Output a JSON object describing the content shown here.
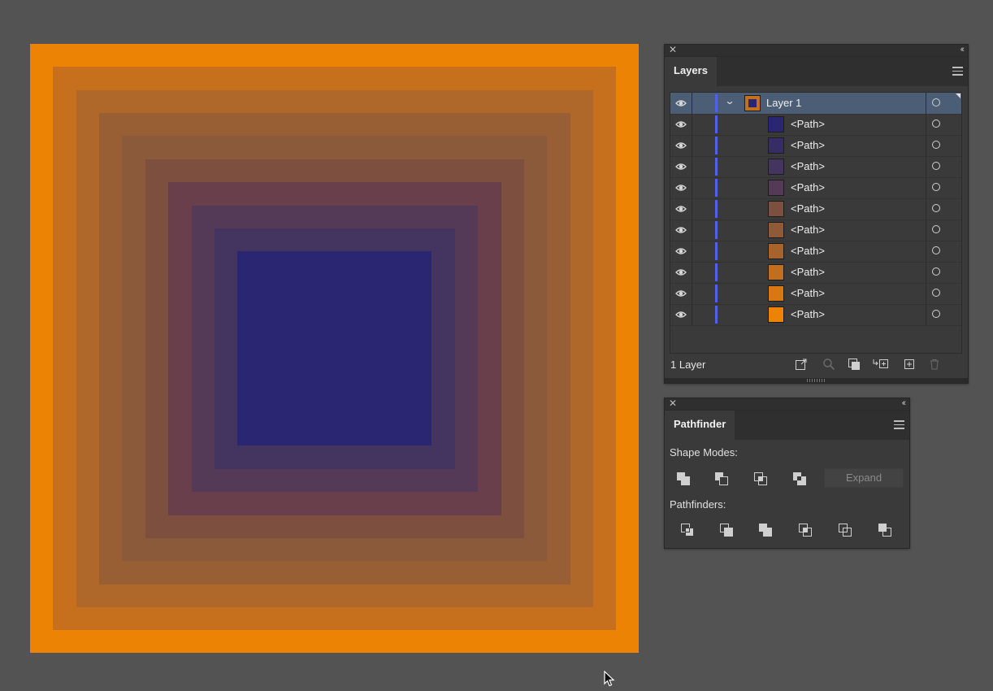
{
  "artboard": {
    "squares": [
      "#ec8305",
      "#c6701d",
      "#b0682a",
      "#985f34",
      "#8a5a3a",
      "#7d4f3f",
      "#683f4b",
      "#553a57",
      "#443460",
      "#2b2672"
    ]
  },
  "layers_panel": {
    "title": "Layers",
    "layer": {
      "name": "Layer 1",
      "color": "#4f63ea"
    },
    "paths": [
      {
        "name": "<Path>",
        "color": "#2b2672"
      },
      {
        "name": "<Path>",
        "color": "#362c66"
      },
      {
        "name": "<Path>",
        "color": "#443460"
      },
      {
        "name": "<Path>",
        "color": "#553a57"
      },
      {
        "name": "<Path>",
        "color": "#7d4f3f"
      },
      {
        "name": "<Path>",
        "color": "#8f5a35"
      },
      {
        "name": "<Path>",
        "color": "#a8632c"
      },
      {
        "name": "<Path>",
        "color": "#c16e20"
      },
      {
        "name": "<Path>",
        "color": "#d87812"
      },
      {
        "name": "<Path>",
        "color": "#ec8305"
      }
    ],
    "footer": {
      "count": "1 Layer"
    }
  },
  "pathfinder_panel": {
    "title": "Pathfinder",
    "shape_modes_label": "Shape Modes:",
    "pathfinders_label": "Pathfinders:",
    "expand_label": "Expand"
  },
  "icons": [
    "close-icon",
    "collapse-icon",
    "panel-menu-icon",
    "eye-icon",
    "chevron-down-icon",
    "target-icon",
    "collect-export-icon",
    "locate-object-icon",
    "make-clipping-mask-icon",
    "new-sublayer-icon",
    "new-layer-icon",
    "trash-icon",
    "unite-icon",
    "minus-front-icon",
    "intersect-icon",
    "exclude-icon",
    "divide-icon",
    "trim-icon",
    "merge-icon",
    "crop-icon",
    "outline-icon",
    "minus-back-icon",
    "cursor-icon"
  ]
}
